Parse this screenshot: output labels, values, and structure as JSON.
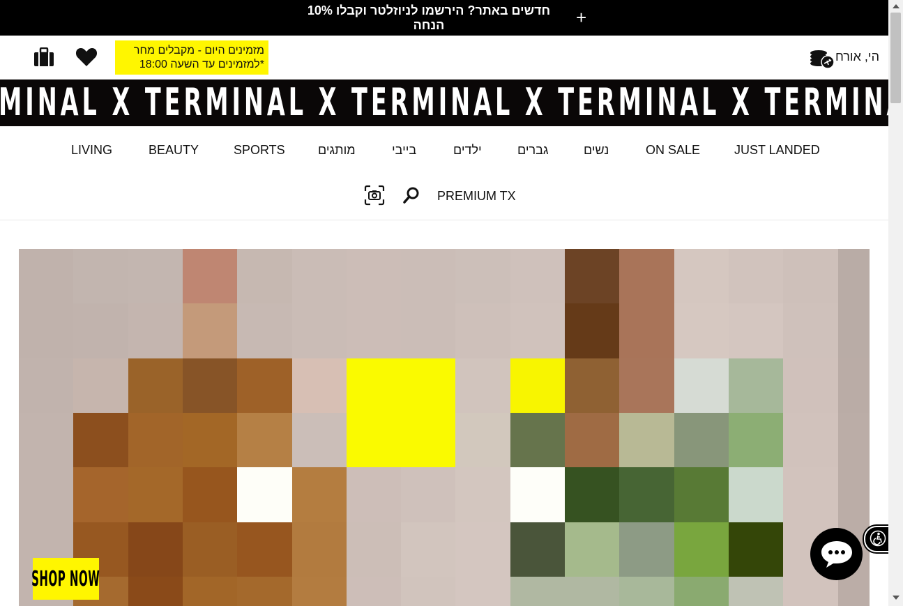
{
  "topbar": {
    "promo_text": "חדשים באתר? הירשמו לניוזלטר וקבלו 10% הנחה",
    "close_symbol": "+"
  },
  "header": {
    "delivery_line1": "מזמינים היום - מקבלים מחר",
    "delivery_line2": "*למזמינים עד השעה 18:00",
    "greeting": "הי, אורח",
    "icons": [
      "shopping-bag-icon",
      "heart-icon",
      "coins-plane-icon"
    ]
  },
  "marquee": {
    "text": "MINAL X TERMINAL X TERMINAL X TERMINAL X TERMINAL X TERMINAL X TERMINA"
  },
  "nav": {
    "row1": [
      "JUST LANDED",
      "ON SALE",
      "נשים",
      "גברים",
      "ילדים",
      "בייבי",
      "מותגים",
      "SPORTS",
      "BEAUTY",
      "LIVING"
    ],
    "row2": [
      "PREMIUM TX"
    ]
  },
  "hero": {
    "cta_label": "SHOP NOW"
  },
  "colors": {
    "accent_yellow": "#fff600",
    "black": "#000000"
  }
}
